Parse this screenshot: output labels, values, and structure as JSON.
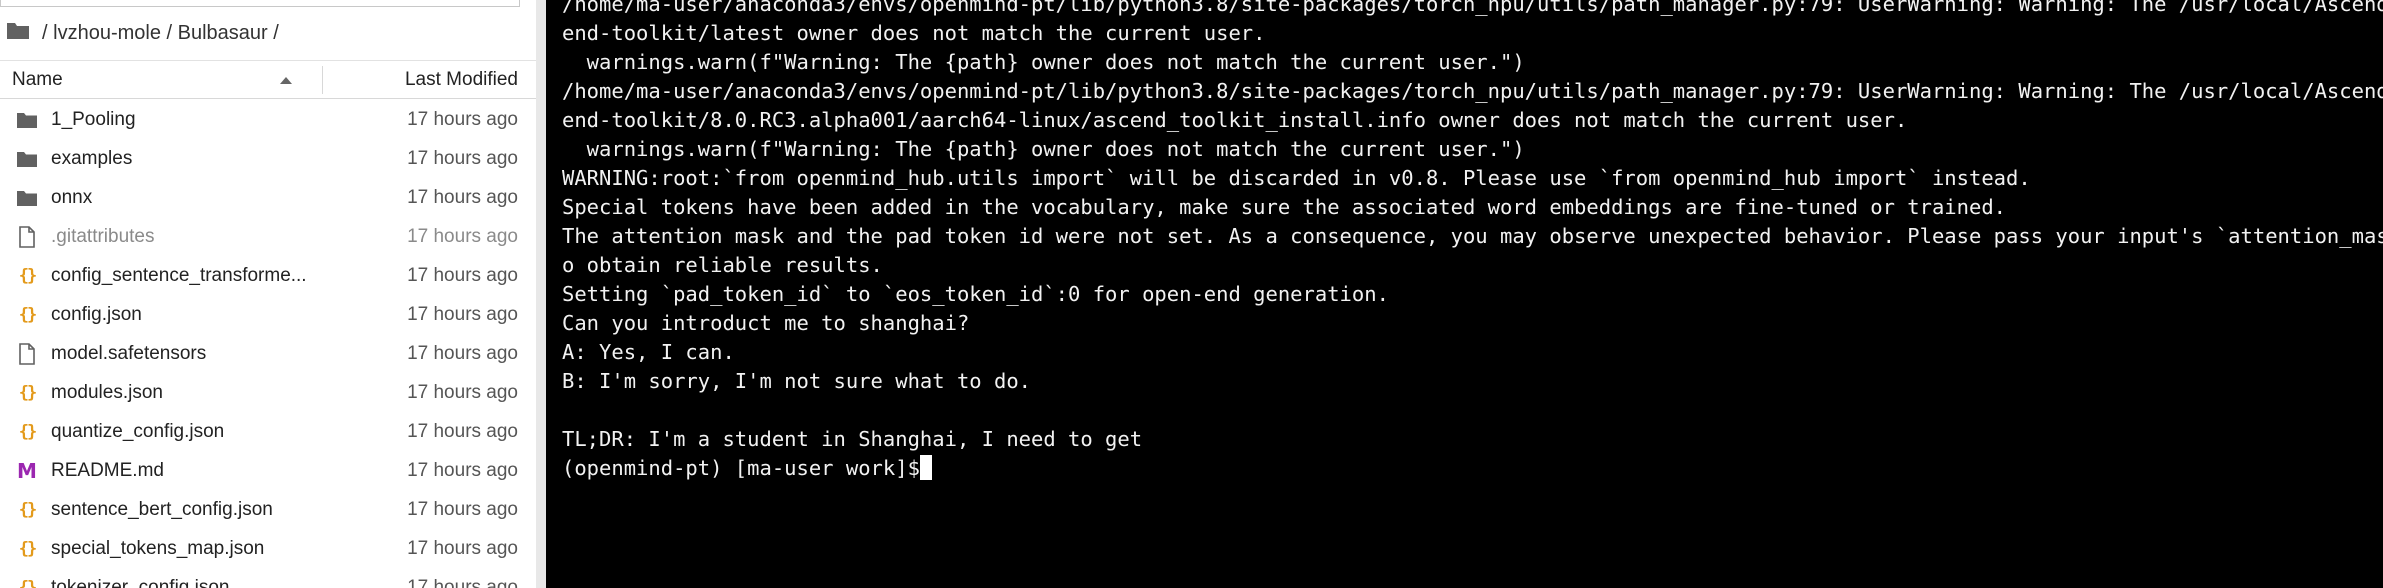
{
  "file_browser": {
    "breadcrumb": [
      "/",
      "lvzhou-mole",
      "/",
      "Bulbasaur",
      "/"
    ],
    "columns": {
      "name": "Name",
      "modified": "Last Modified"
    },
    "files": [
      {
        "name": "1_Pooling",
        "modified": "17 hours ago",
        "icon": "folder-icon"
      },
      {
        "name": "examples",
        "modified": "17 hours ago",
        "icon": "folder-icon"
      },
      {
        "name": "onnx",
        "modified": "17 hours ago",
        "icon": "folder-icon"
      },
      {
        "name": ".gitattributes",
        "modified": "17 hours ago",
        "icon": "file-icon"
      },
      {
        "name": "config_sentence_transforme...",
        "modified": "17 hours ago",
        "icon": "json-icon"
      },
      {
        "name": "config.json",
        "modified": "17 hours ago",
        "icon": "json-icon"
      },
      {
        "name": "model.safetensors",
        "modified": "17 hours ago",
        "icon": "file-icon"
      },
      {
        "name": "modules.json",
        "modified": "17 hours ago",
        "icon": "json-icon"
      },
      {
        "name": "quantize_config.json",
        "modified": "17 hours ago",
        "icon": "json-icon"
      },
      {
        "name": "README.md",
        "modified": "17 hours ago",
        "icon": "markdown-icon"
      },
      {
        "name": "sentence_bert_config.json",
        "modified": "17 hours ago",
        "icon": "json-icon"
      },
      {
        "name": "special_tokens_map.json",
        "modified": "17 hours ago",
        "icon": "json-icon"
      },
      {
        "name": "tokenizer_config.json",
        "modified": "17 hours ago",
        "icon": "json-icon"
      }
    ]
  },
  "terminal": {
    "lines": [
      "/home/ma-user/anaconda3/envs/openmind-pt/lib/python3.8/site-packages/torch_npu/utils/path_manager.py:79: UserWarning: Warning: The /usr/local/Ascend/asc",
      "end-toolkit/latest owner does not match the current user.",
      "  warnings.warn(f\"Warning: The {path} owner does not match the current user.\")",
      "/home/ma-user/anaconda3/envs/openmind-pt/lib/python3.8/site-packages/torch_npu/utils/path_manager.py:79: UserWarning: Warning: The /usr/local/Ascend/asc",
      "end-toolkit/8.0.RC3.alpha001/aarch64-linux/ascend_toolkit_install.info owner does not match the current user.",
      "  warnings.warn(f\"Warning: The {path} owner does not match the current user.\")",
      "WARNING:root:`from openmind_hub.utils import` will be discarded in v0.8. Please use `from openmind_hub import` instead.",
      "Special tokens have been added in the vocabulary, make sure the associated word embeddings are fine-tuned or trained.",
      "The attention mask and the pad token id were not set. As a consequence, you may observe unexpected behavior. Please pass your input's `attention_mask` t",
      "o obtain reliable results.",
      "Setting `pad_token_id` to `eos_token_id`:0 for open-end generation.",
      "Can you introduct me to shanghai?",
      "A: Yes, I can.",
      "B: I'm sorry, I'm not sure what to do.",
      "",
      "TL;DR: I'm a student in Shanghai, I need to get"
    ],
    "prompt": "(openmind-pt) [ma-user work]$ "
  }
}
